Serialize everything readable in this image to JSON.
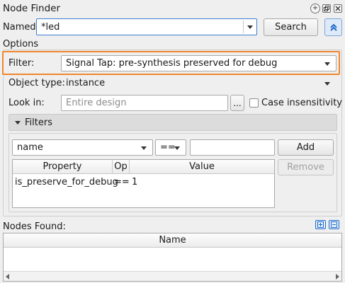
{
  "window": {
    "title": "Node Finder"
  },
  "titlebar_buttons": [
    "plus-circle-icon",
    "restore-icon",
    "close-icon"
  ],
  "named": {
    "label": "Named:",
    "value": "*led"
  },
  "search_button": "Search",
  "options_label": "Options",
  "filter": {
    "label": "Filter:",
    "value": "Signal Tap: pre-synthesis preserved for debug"
  },
  "object_type": {
    "label": "Object type:",
    "value": "instance"
  },
  "look_in": {
    "label": "Look in:",
    "placeholder": "Entire design",
    "browse": "...",
    "case_label": "Case insensitivity",
    "case_checked": false
  },
  "filters_section": {
    "title": "Filters",
    "property_select": "name",
    "op_select": "==",
    "value_input": "",
    "add_button": "Add",
    "remove_button": "Remove",
    "columns": [
      "Property",
      "Op",
      "Value"
    ],
    "rows": [
      {
        "property": "is_preserve_for_debug",
        "op": "==",
        "value": "1"
      }
    ]
  },
  "nodes_found": {
    "label": "Nodes Found:",
    "columns": [
      "Name"
    ]
  },
  "colors": {
    "highlight": "#f0862d",
    "accent": "#1b6ac9"
  }
}
